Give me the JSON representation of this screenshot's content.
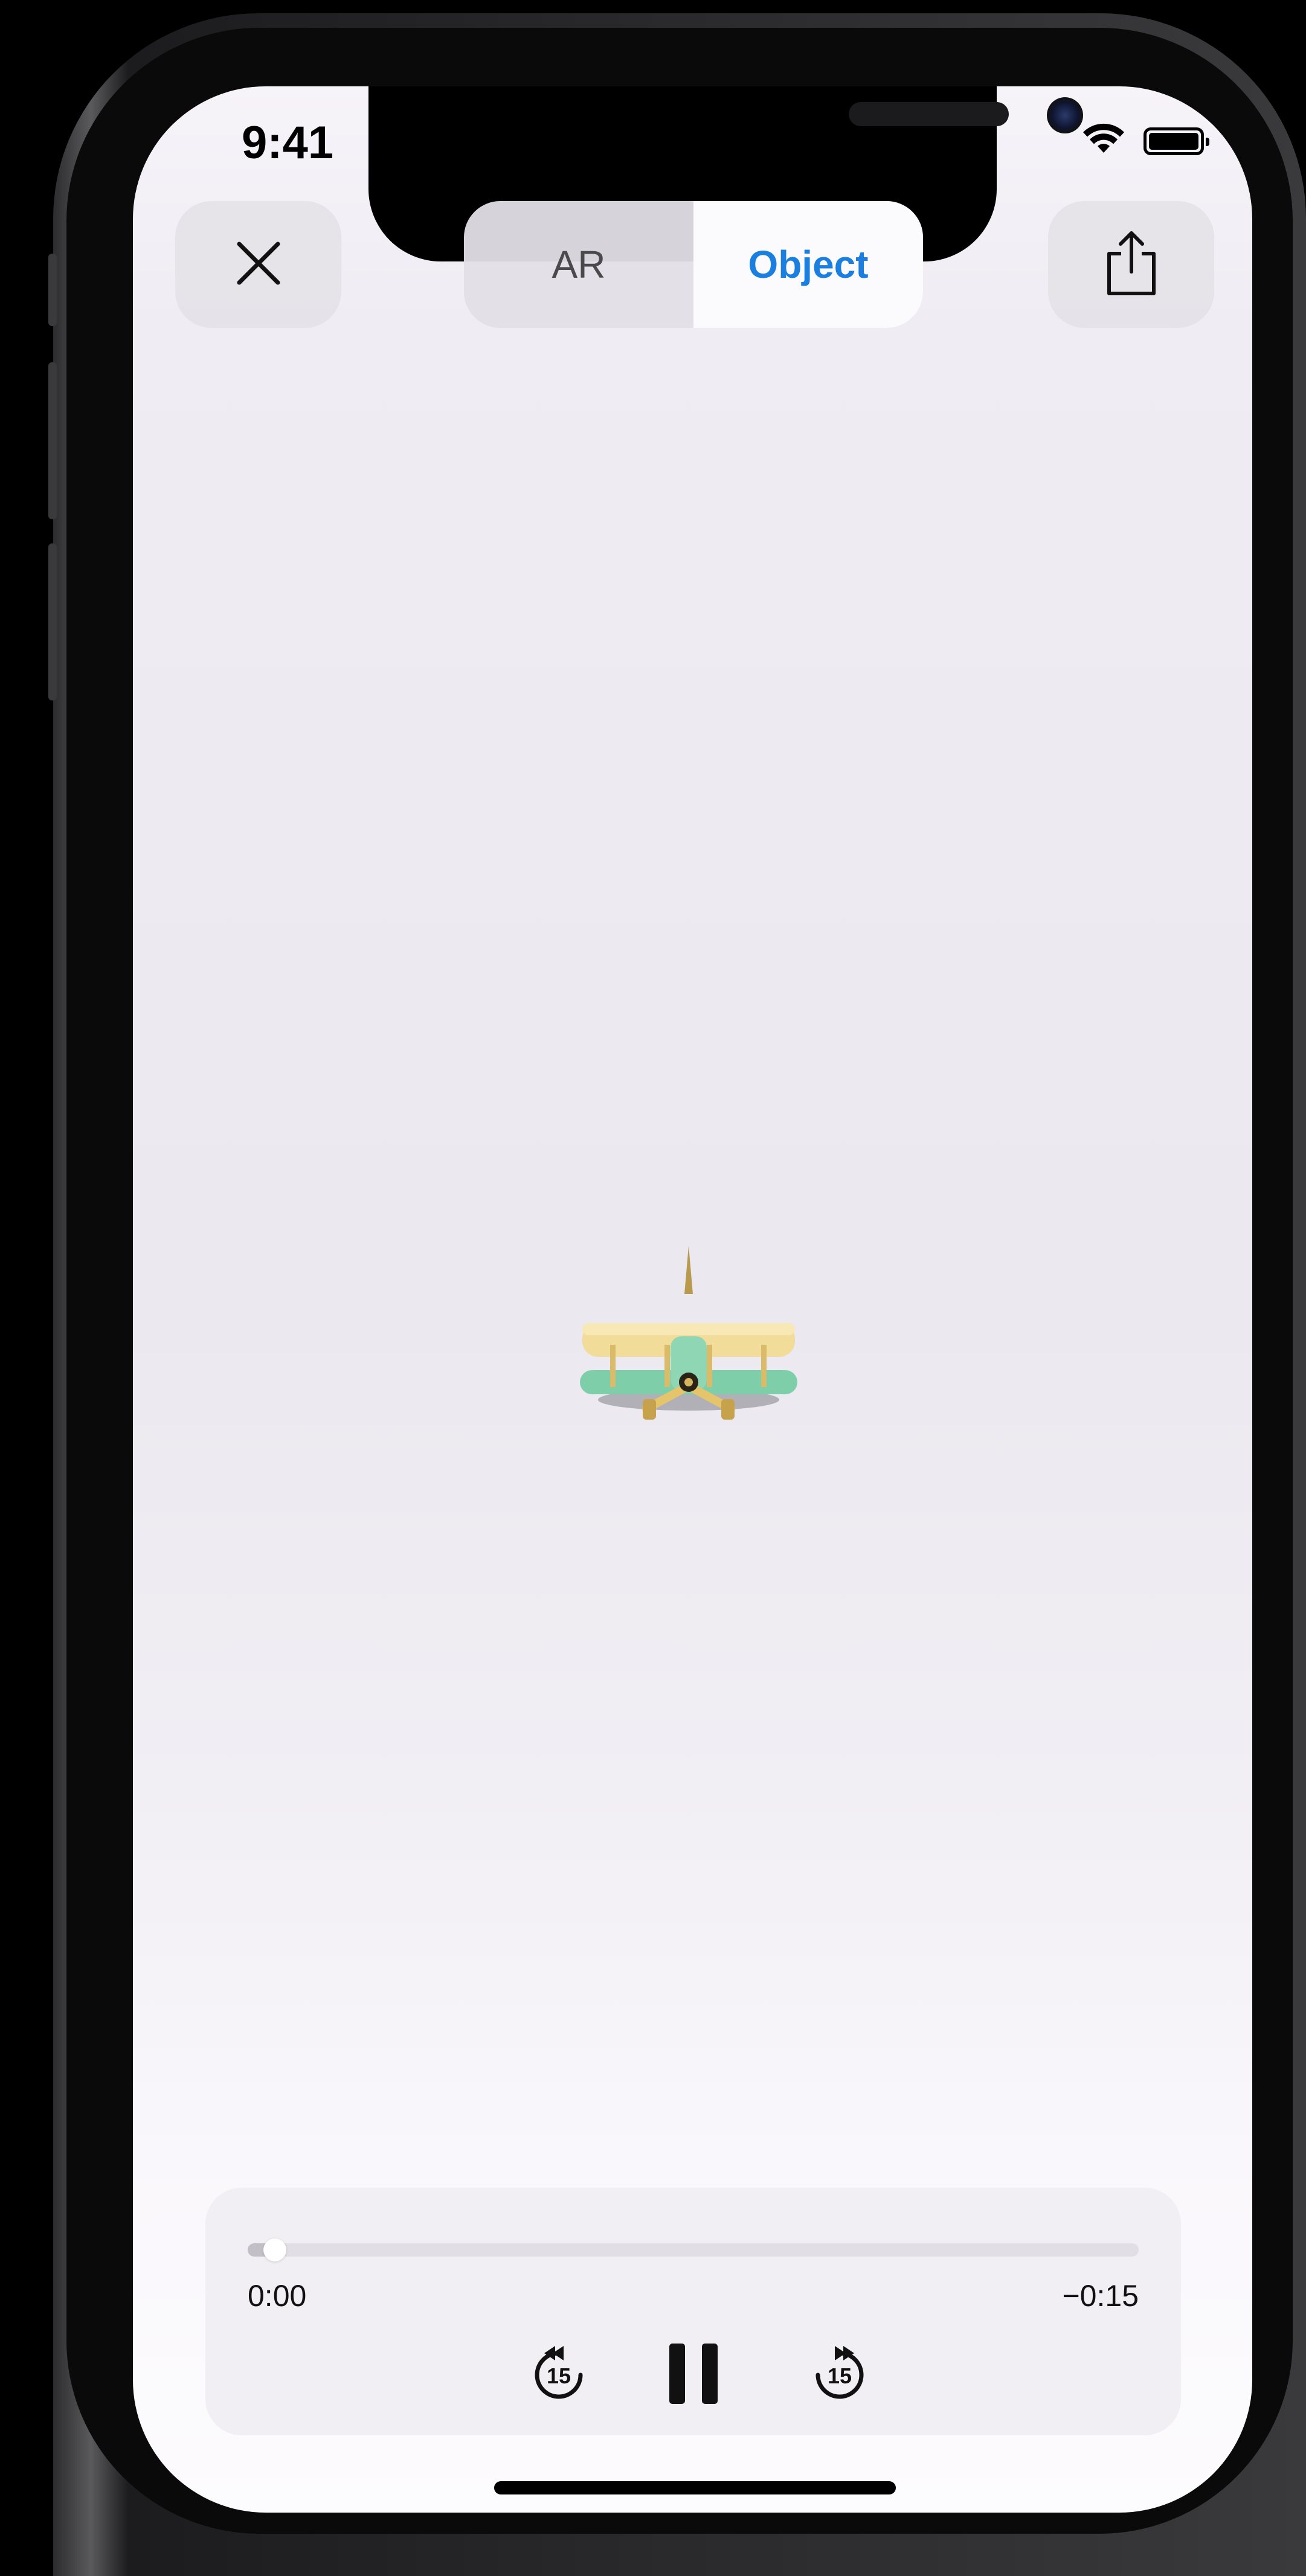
{
  "status_bar": {
    "time": "9:41",
    "icons": [
      "wifi-icon",
      "battery-icon"
    ]
  },
  "top_bar": {
    "close_icon": "close-icon",
    "segments": [
      {
        "label": "AR",
        "selected": false
      },
      {
        "label": "Object",
        "selected": true
      }
    ],
    "share_icon": "share-icon"
  },
  "viewer": {
    "model_icon": "biplane-model-icon"
  },
  "player": {
    "elapsed": "0:00",
    "remaining": "−0:15",
    "progress_fraction": 0.03,
    "skip_back_label": "15",
    "skip_forward_label": "15"
  },
  "colors": {
    "accent": "#1b7fe0",
    "background": "#ebe8ef"
  }
}
